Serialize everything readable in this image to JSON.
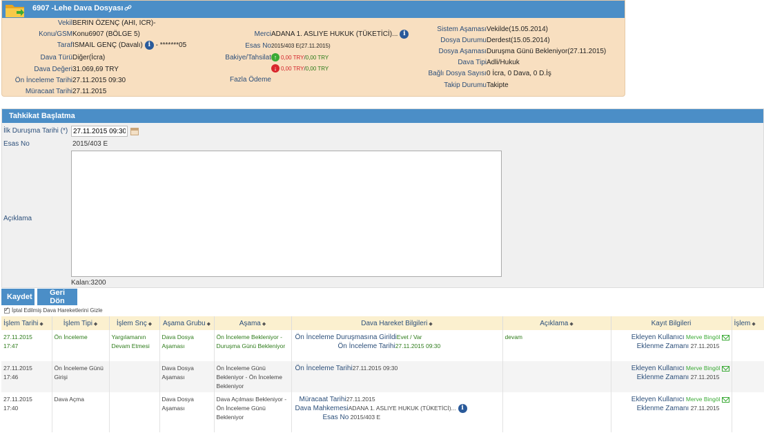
{
  "file": {
    "title": "6907 -Lehe Dava Dosyası",
    "vekil_k": "Vekil",
    "vekil_v": "BERIN ÖZENÇ (AHI, ICR)-",
    "konu_k": "Konu/GSM",
    "konu_v": "Konu6907 (BÖLGE 5)",
    "taraf_k": "Taraf",
    "taraf_v": "ISMAIL GENÇ (Davalı)",
    "taraf_mask": " - *******05",
    "turu_k": "Dava Türü",
    "turu_v": "Diğer(İcra)",
    "degeri_k": "Dava Değeri",
    "degeri_v": "31.069,69 TRY",
    "on_inceleme_k": "Ön İnceleme Tarihi",
    "on_inceleme_v": "27.11.2015 09:30",
    "muracaat_k": "Müracaat Tarihi",
    "muracaat_v": "27.11.2015",
    "merci_k": "Merci",
    "merci_v": "ADANA 1. ASLIYE HUKUK (TÜKETİCİ)...",
    "esas_k": "Esas No",
    "esas_v": "2015/403 E(27.11.2015)",
    "bakiye_k": "Bakiye/Tahsilat",
    "bakiye_up_red": "0,00 TRY",
    "bakiye_up_green": "0,00 TRY",
    "bakiye_down_red": "0,00 TRY",
    "bakiye_down_green": "0,00 TRY",
    "fazla_k": "Fazla Ödeme",
    "sistem_k": "Sistem Aşaması",
    "sistem_v": "Vekilde(15.05.2014)",
    "durumu_k": "Dosya Durumu",
    "durumu_v": "Derdest(15.05.2014)",
    "dosya_asama_k": "Dosya Aşaması",
    "dosya_asama_v": "Duruşma Günü Bekleniyor(27.11.2015)",
    "tipi_k": "Dava Tipi",
    "tipi_v": "Adli/Hukuk",
    "bagli_k": "Bağlı Dosya Sayısı",
    "bagli_v": "0 İcra, 0 Dava, 0 D.İş",
    "takip_k": "Takip Durumu",
    "takip_v": "Takipte"
  },
  "tahkikat": {
    "title": "Tahkikat Başlatma",
    "ilk_label": "İlk Duruşma Tarihi (*)",
    "ilk_value": "27.11.2015 09:30",
    "esas_label": "Esas No",
    "esas_value": "2015/403 E",
    "aciklama_label": "Açıklama",
    "kalan": "Kalan:3200"
  },
  "buttons": {
    "kaydet": "Kaydet",
    "geri": "Geri Dön"
  },
  "checkbox_label": "İptal Edilmiş Dava Hareketlerini Gizle",
  "grid": {
    "headers": [
      "İşlem Tarihi",
      "İşlem Tipi",
      "İşlem Snç",
      "Aşama Grubu",
      "Aşama",
      "Dava Hareket Bilgileri",
      "Açıklama",
      "Kayıt Bilgileri",
      "İşlem"
    ],
    "sort_glyph": "◆",
    "rows": [
      {
        "date": "27.11.2015",
        "time": "17:47",
        "tip": "Ön İnceleme",
        "snc": "Yargılamanın Devam Etmesi",
        "grup": "Dava Dosya Aşaması",
        "asama": "Ön İnceleme Bekleniyor - Duruşma Günü Bekleniyor",
        "h1k": "Ön İnceleme Duruşmasına Girildi",
        "h1v": "Evet / Var",
        "h2k": "Ön İnceleme Tarihi",
        "h2v": "27.11.2015 09:30",
        "aciklama": "devam",
        "ekleyen_k": "Ekleyen Kullanıcı",
        "ekleyen_v": "Merve Bingöl",
        "zaman_k": "Eklenme Zamanı",
        "zaman_v": "27.11.2015"
      },
      {
        "date": "27.11.2015",
        "time": "17:46",
        "tip": "Ön İnceleme Günü Girişi",
        "snc": "",
        "grup": "Dava Dosya Aşaması",
        "asama": "Ön İnceleme Günü Bekleniyor - Ön İnceleme Bekleniyor",
        "h1k": "Ön İnceleme Tarihi",
        "h1v": "27.11.2015 09:30",
        "aciklama": "",
        "ekleyen_k": "Ekleyen Kullanıcı",
        "ekleyen_v": "Merve Bingöl",
        "zaman_k": "Eklenme Zamanı",
        "zaman_v": "27.11.2015"
      },
      {
        "date": "27.11.2015",
        "time": "17:40",
        "tip": "Dava Açma",
        "snc": "",
        "grup": "Dava Dosya Aşaması",
        "asama": "Dava Açılması Bekleniyor - Ön İnceleme Günü Bekleniyor",
        "h1k": "Müracaat Tarihi",
        "h1v": "27.11.2015",
        "h2k": "Dava Mahkemesi",
        "h2v": "ADANA 1. ASLIYE HUKUK (TÜKETİCİ)...",
        "h3k": "Esas No",
        "h3v": "2015/403 E",
        "aciklama": "",
        "ekleyen_k": "Ekleyen Kullanıcı",
        "ekleyen_v": "Merve Bingöl",
        "zaman_k": "Eklenme Zamanı",
        "zaman_v": "27.11.2015"
      }
    ]
  }
}
